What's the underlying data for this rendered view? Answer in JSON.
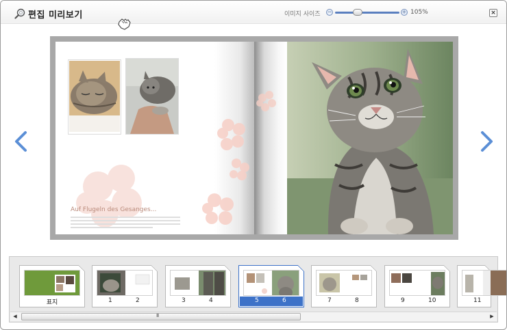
{
  "window": {
    "title": "편집 미리보기",
    "zoom_label": "이미지 사이즈",
    "zoom_value": "105%",
    "zoom_fraction": 0.35,
    "zoom_minus": "−",
    "zoom_plus": "+",
    "close_label": "×"
  },
  "preview": {
    "heading": "Auf Flugeln des Gesanges...",
    "accent_color": "#3d72c8",
    "arrow_color": "#5b8fd6"
  },
  "filmstrip": {
    "thumbnails": [
      {
        "labels": [
          "표지"
        ],
        "selected": false
      },
      {
        "labels": [
          "1",
          "2"
        ],
        "selected": false
      },
      {
        "labels": [
          "3",
          "4"
        ],
        "selected": false
      },
      {
        "labels": [
          "5",
          "6"
        ],
        "selected": true
      },
      {
        "labels": [
          "7",
          "8"
        ],
        "selected": false
      },
      {
        "labels": [
          "9",
          "10"
        ],
        "selected": false
      },
      {
        "labels": [
          "11"
        ],
        "selected": false
      }
    ],
    "scroll_left": "◀",
    "scroll_right": "▶",
    "scroll_grip": "III"
  }
}
